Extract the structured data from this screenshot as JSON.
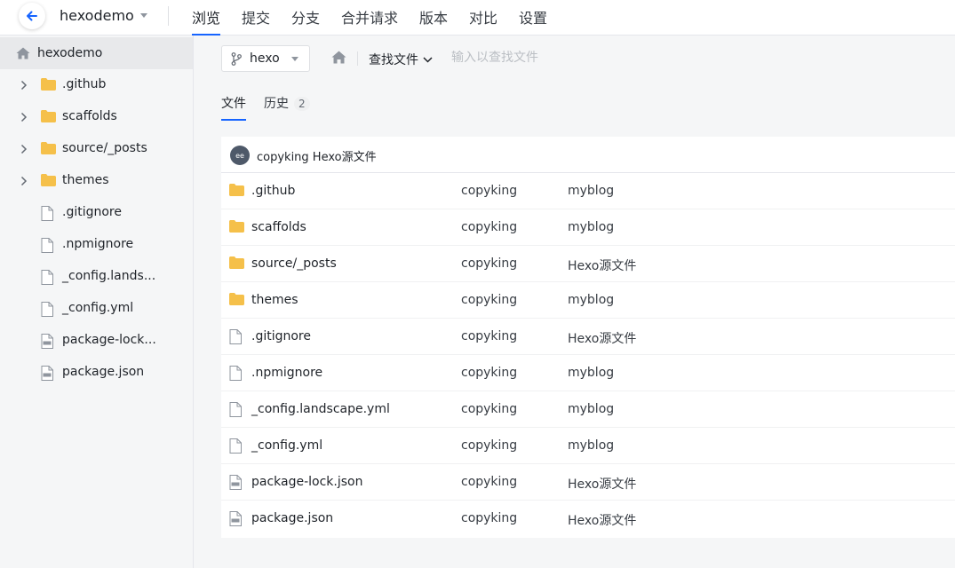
{
  "header": {
    "repo_name": "hexodemo",
    "tabs": [
      {
        "label": "浏览",
        "active": true
      },
      {
        "label": "提交",
        "active": false
      },
      {
        "label": "分支",
        "active": false
      },
      {
        "label": "合并请求",
        "active": false
      },
      {
        "label": "版本",
        "active": false
      },
      {
        "label": "对比",
        "active": false
      },
      {
        "label": "设置",
        "active": false
      }
    ]
  },
  "sidebar": {
    "root_label": "hexodemo",
    "items": [
      {
        "label": ".github",
        "type": "folder"
      },
      {
        "label": "scaffolds",
        "type": "folder"
      },
      {
        "label": "source/_posts",
        "type": "folder"
      },
      {
        "label": "themes",
        "type": "folder"
      },
      {
        "label": ".gitignore",
        "type": "file"
      },
      {
        "label": ".npmignore",
        "type": "file"
      },
      {
        "label": "_config.lands...",
        "type": "file"
      },
      {
        "label": "_config.yml",
        "type": "file"
      },
      {
        "label": "package-lock...",
        "type": "json"
      },
      {
        "label": "package.json",
        "type": "json"
      }
    ]
  },
  "toolbar": {
    "branch": "hexo",
    "find_file_label": "查找文件",
    "find_placeholder": "输入以查找文件"
  },
  "subtabs": {
    "files": "文件",
    "history": "历史",
    "history_count": "2"
  },
  "commit": {
    "avatar_text": "ee",
    "text": "copyking Hexo源文件"
  },
  "files": [
    {
      "name": ".github",
      "type": "folder",
      "author": "copyking",
      "message": "myblog"
    },
    {
      "name": "scaffolds",
      "type": "folder",
      "author": "copyking",
      "message": "myblog"
    },
    {
      "name": "source/_posts",
      "type": "folder",
      "author": "copyking",
      "message": "Hexo源文件"
    },
    {
      "name": "themes",
      "type": "folder",
      "author": "copyking",
      "message": "myblog"
    },
    {
      "name": ".gitignore",
      "type": "file",
      "author": "copyking",
      "message": "Hexo源文件"
    },
    {
      "name": ".npmignore",
      "type": "file",
      "author": "copyking",
      "message": "myblog"
    },
    {
      "name": "_config.landscape.yml",
      "type": "file",
      "author": "copyking",
      "message": "myblog"
    },
    {
      "name": "_config.yml",
      "type": "file",
      "author": "copyking",
      "message": "myblog"
    },
    {
      "name": "package-lock.json",
      "type": "json",
      "author": "copyking",
      "message": "Hexo源文件"
    },
    {
      "name": "package.json",
      "type": "json",
      "author": "copyking",
      "message": "Hexo源文件"
    }
  ],
  "colors": {
    "accent": "#1664ff",
    "folder": "#f5c04a"
  }
}
